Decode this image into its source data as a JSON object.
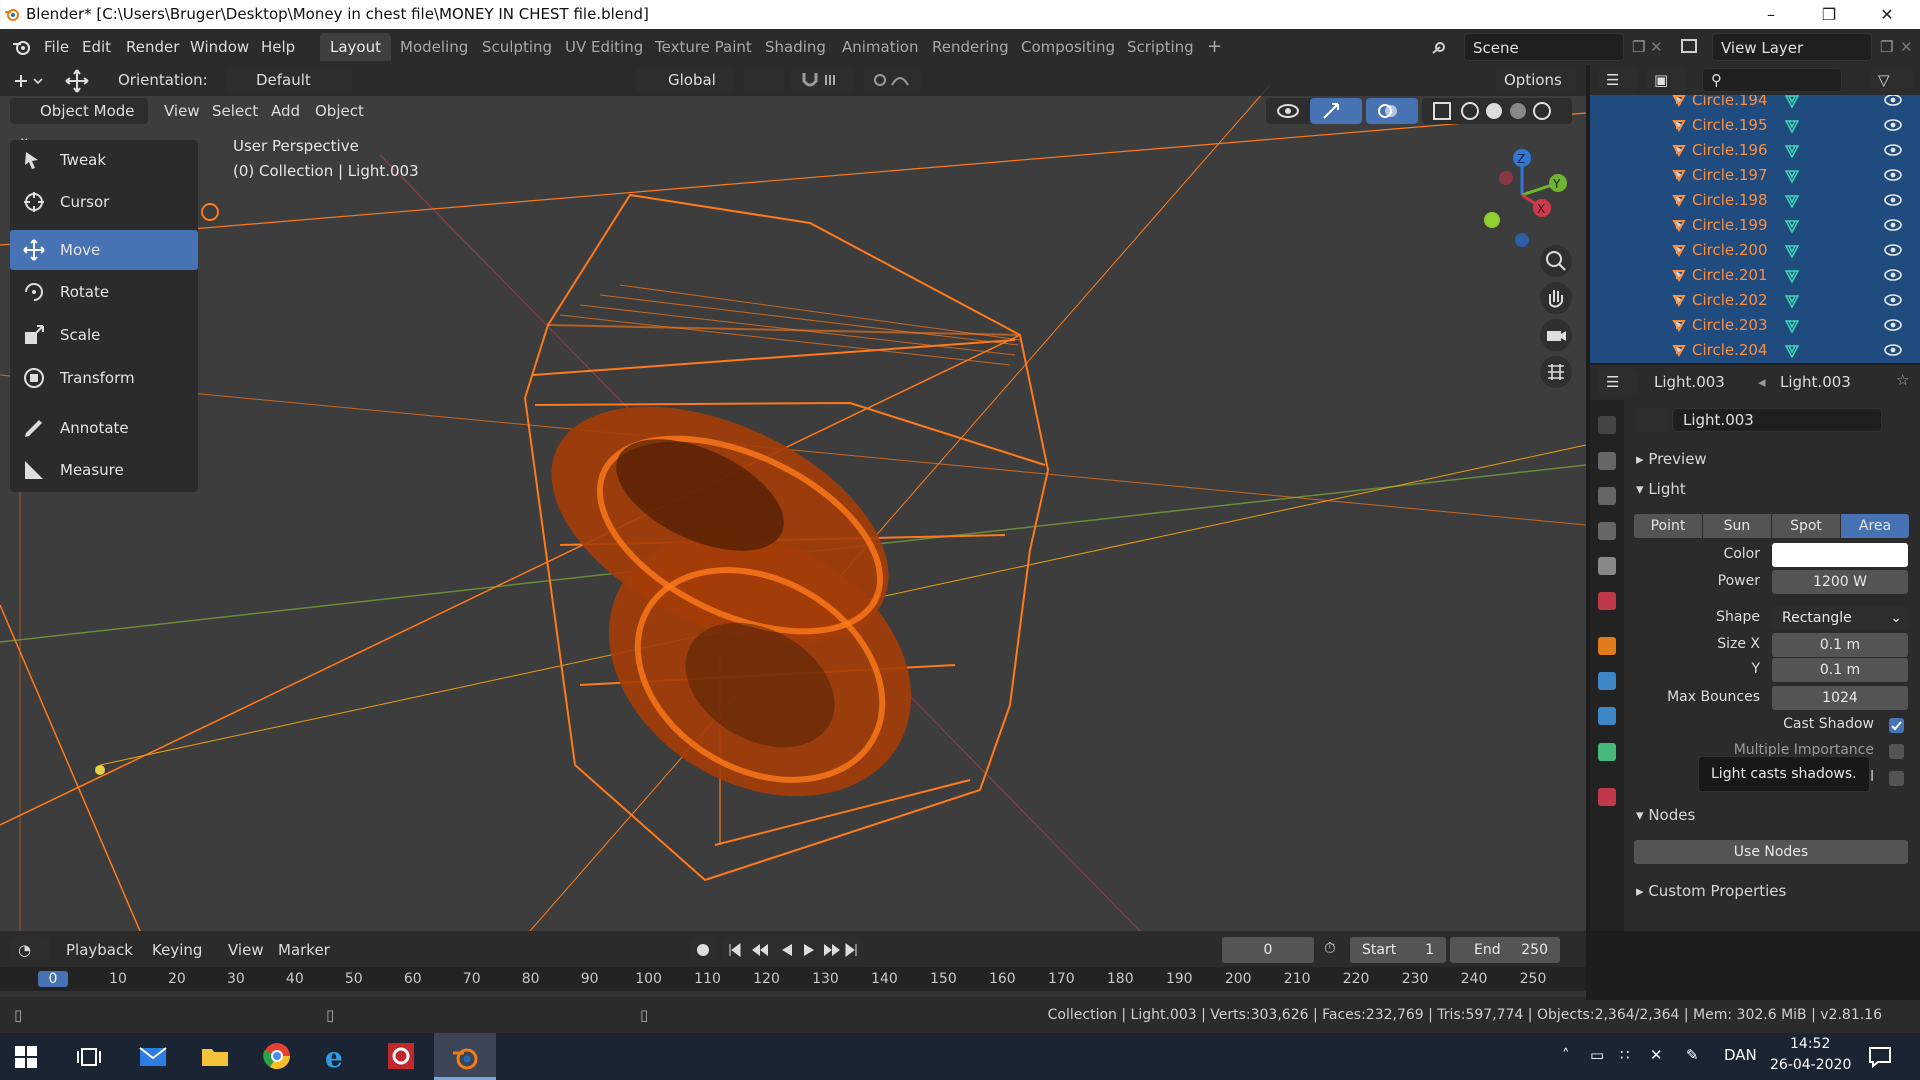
{
  "window": {
    "title": "Blender* [C:\\Users\\Bruger\\Desktop\\Money in chest file\\MONEY IN CHEST  file.blend]",
    "minimize": "–",
    "maximize": "❐",
    "close": "✕"
  },
  "menu": [
    "File",
    "Edit",
    "Render",
    "Window",
    "Help"
  ],
  "workspaces": [
    "Layout",
    "Modeling",
    "Sculpting",
    "UV Editing",
    "Texture Paint",
    "Shading",
    "Animation",
    "Rendering",
    "Compositing",
    "Scripting"
  ],
  "workspace_add": "+",
  "scene": {
    "label": "Scene",
    "view_layer": "View Layer"
  },
  "viewport_header": {
    "orientation_label": "Orientation:",
    "orientation_value": "Default",
    "transform_orientation": "Global",
    "options": "Options",
    "mode": "Object Mode",
    "menus": [
      "View",
      "Select",
      "Add",
      "Object"
    ]
  },
  "viewport_overlay": {
    "perspective": "User Perspective",
    "collection_info": "(0) Collection | Light.003"
  },
  "axes": {
    "z": "Z",
    "y": "Y",
    "x": "X"
  },
  "tools": [
    {
      "label": "Tweak",
      "icon": "tweak-icon"
    },
    {
      "label": "Cursor",
      "icon": "cursor-icon"
    },
    {
      "label": "Move",
      "icon": "move-icon",
      "active": true
    },
    {
      "label": "Rotate",
      "icon": "rotate-icon"
    },
    {
      "label": "Scale",
      "icon": "scale-icon"
    },
    {
      "label": "Transform",
      "icon": "transform-icon"
    },
    {
      "label": "Annotate",
      "icon": "annotate-icon"
    },
    {
      "label": "Measure",
      "icon": "measure-icon"
    }
  ],
  "outliner": {
    "items": [
      "Circle.194",
      "Circle.195",
      "Circle.196",
      "Circle.197",
      "Circle.198",
      "Circle.199",
      "Circle.200",
      "Circle.201",
      "Circle.202",
      "Circle.203",
      "Circle.204"
    ]
  },
  "properties": {
    "object_name": "Light.003",
    "data_name": "Light.003",
    "datablock": "Light.003",
    "sections": {
      "preview": "Preview",
      "light": "Light",
      "nodes": "Nodes",
      "custom": "Custom Properties"
    },
    "light_types": [
      "Point",
      "Sun",
      "Spot",
      "Area"
    ],
    "active_type": "Area",
    "color_label": "Color",
    "color_value": "#ffffff",
    "power_label": "Power",
    "power_value": "1200 W",
    "shape_label": "Shape",
    "shape_value": "Rectangle",
    "size_x_label": "Size X",
    "size_x_value": "0.1 m",
    "size_y_label": "Y",
    "size_y_value": "0.1 m",
    "max_bounces_label": "Max Bounces",
    "max_bounces_value": "1024",
    "cast_shadow_label": "Cast Shadow",
    "cast_shadow": true,
    "mis_label": "Multiple Importance",
    "portal_label": "al",
    "tooltip": "Light casts shadows.",
    "use_nodes": "Use Nodes"
  },
  "timeline": {
    "menus": [
      "Playback",
      "Keying",
      "View",
      "Marker"
    ],
    "current_frame": "0",
    "start_label": "Start",
    "start_value": "1",
    "end_label": "End",
    "end_value": "250",
    "ticks": [
      "0",
      "10",
      "20",
      "30",
      "40",
      "50",
      "60",
      "70",
      "80",
      "90",
      "100",
      "110",
      "120",
      "130",
      "140",
      "150",
      "160",
      "170",
      "180",
      "190",
      "200",
      "210",
      "220",
      "230",
      "240",
      "250"
    ]
  },
  "status": "Collection | Light.003 | Verts:303,626 | Faces:232,769 | Tris:597,774 | Objects:2,364/2,364 | Mem: 302.6 MiB | v2.81.16",
  "taskbar": {
    "lang": "DAN",
    "time": "14:52",
    "date": "26-04-2020"
  },
  "colors": {
    "accent": "#4772b3",
    "selection_orange": "#ff7a1a",
    "outliner_bg": "#1f4b7e"
  }
}
